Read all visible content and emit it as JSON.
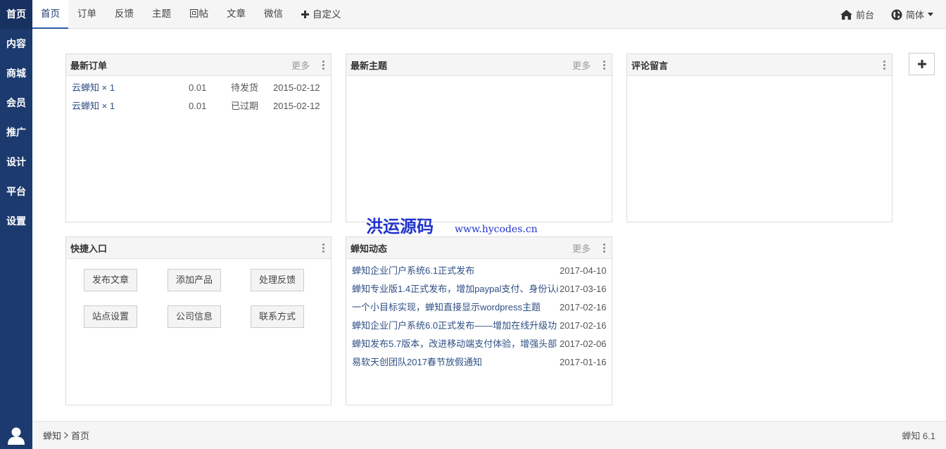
{
  "sidebar": {
    "items": [
      {
        "label": "首页"
      },
      {
        "label": "内容"
      },
      {
        "label": "商城"
      },
      {
        "label": "会员"
      },
      {
        "label": "推广"
      },
      {
        "label": "设计"
      },
      {
        "label": "平台"
      },
      {
        "label": "设置"
      }
    ],
    "user_icon": "user-icon"
  },
  "topnav": {
    "tabs": [
      {
        "label": "首页"
      },
      {
        "label": "订单"
      },
      {
        "label": "反馈"
      },
      {
        "label": "主题"
      },
      {
        "label": "回帖"
      },
      {
        "label": "文章"
      },
      {
        "label": "微信"
      }
    ],
    "custom_label": "自定义",
    "frontend_label": "前台",
    "language_label": "简体"
  },
  "panels": {
    "orders": {
      "title": "最新订单",
      "more": "更多",
      "rows": [
        {
          "item": "云蝉知 × 1",
          "amount": "0.01",
          "status": "待发货",
          "date": "2015-02-12"
        },
        {
          "item": "云蝉知 × 1",
          "amount": "0.01",
          "status": "已过期",
          "date": "2015-02-12"
        }
      ]
    },
    "threads": {
      "title": "最新主题",
      "more": "更多"
    },
    "comments": {
      "title": "评论留言"
    },
    "shortcuts": {
      "title": "快捷入口",
      "buttons": [
        {
          "label": "发布文章"
        },
        {
          "label": "添加产品"
        },
        {
          "label": "处理反馈"
        },
        {
          "label": "站点设置"
        },
        {
          "label": "公司信息"
        },
        {
          "label": "联系方式"
        }
      ]
    },
    "news": {
      "title": "蝉知动态",
      "more": "更多",
      "rows": [
        {
          "title": "蝉知企业门户系统6.1正式发布",
          "date": "2017-04-10"
        },
        {
          "title": "蝉知专业版1.4正式发布，增加paypal支付、身份认i",
          "date": "2017-03-16"
        },
        {
          "title": "一个小目标实现，蝉知直接显示wordpress主题",
          "date": "2017-02-16"
        },
        {
          "title": "蝉知企业门户系统6.0正式发布——增加在线升级功",
          "date": "2017-02-16"
        },
        {
          "title": "蝉知发布5.7版本，改进移动端支付体验，增强头部",
          "date": "2017-02-06"
        },
        {
          "title": "易软天创团队2017春节放假通知",
          "date": "2017-01-16"
        }
      ]
    }
  },
  "watermark": {
    "name": "洪运源码",
    "url": "www.hycodes.cn"
  },
  "footer": {
    "crumb_root": "蝉知",
    "crumb_current": "首页",
    "version": "蝉知 6.1"
  },
  "colors": {
    "sidebar": "#1d3a6e",
    "accent": "#2d5ba8",
    "link": "#2f4f84"
  }
}
